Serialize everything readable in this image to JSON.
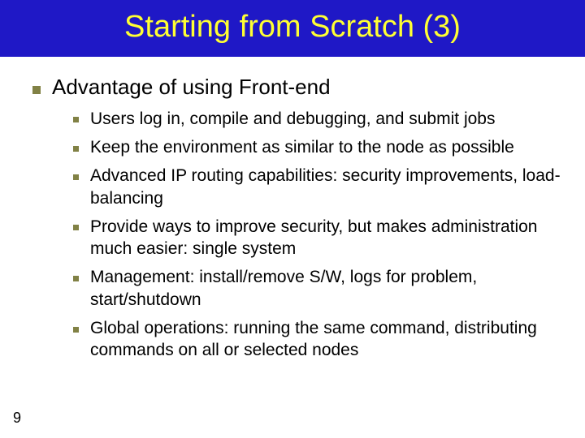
{
  "title": "Starting from Scratch (3)",
  "topic": "Advantage of using Front-end",
  "points": [
    "Users log in, compile and debugging, and submit jobs",
    "Keep the environment as similar to the node as possible",
    "Advanced IP routing capabilities: security improvements, load-balancing",
    "Provide ways to improve security, but makes administration much easier: single system",
    "Management: install/remove S/W, logs for problem, start/shutdown",
    "Global operations: running the same command, distributing commands on all or selected nodes"
  ],
  "slide_number": "9"
}
